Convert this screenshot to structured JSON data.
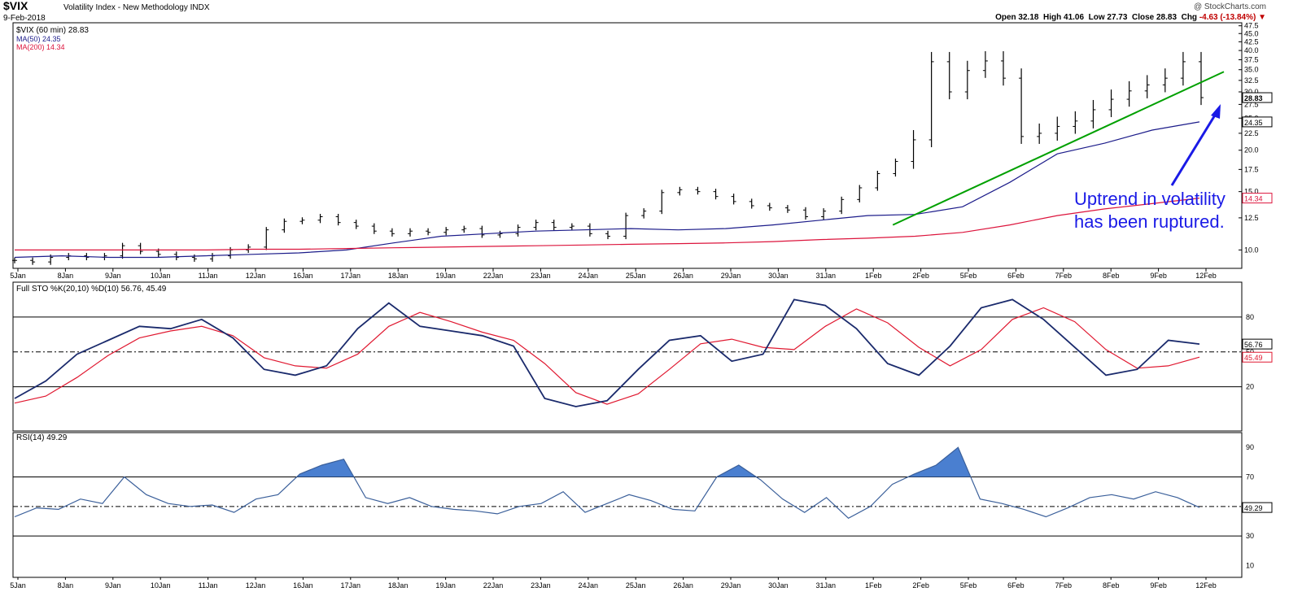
{
  "header": {
    "symbol": "$VIX",
    "name": "Volatility Index - New Methodology  INDX",
    "date": "9-Feb-2018",
    "watermark": "@ StockCharts.com",
    "open_label": "Open",
    "open": "32.18",
    "high_label": "High",
    "high": "41.06",
    "low_label": "Low",
    "low": "27.73",
    "close_label": "Close",
    "close": "28.83",
    "chg_label": "Chg",
    "chg": "-4.63 (-13.84%)",
    "chg_arrow": "▼"
  },
  "colors": {
    "price": "#000000",
    "ma50": "#1c1c8a",
    "ma200": "#dc143c",
    "trendline": "#00a000",
    "annotation": "#1a1ae6",
    "sto_k": "#1a2a6c",
    "sto_d": "#e01830",
    "rsi_line": "#3a5f9a",
    "rsi_fill": "#4a7fd0"
  },
  "x_axis_dates": [
    "5Jan",
    "8Jan",
    "9Jan",
    "10Jan",
    "11Jan",
    "12Jan",
    "16Jan",
    "17Jan",
    "18Jan",
    "19Jan",
    "22Jan",
    "23Jan",
    "24Jan",
    "25Jan",
    "26Jan",
    "29Jan",
    "30Jan",
    "31Jan",
    "1Feb",
    "2Feb",
    "5Feb",
    "6Feb",
    "7Feb",
    "8Feb",
    "9Feb",
    "12Feb"
  ],
  "chart_data": [
    {
      "type": "line",
      "panel": "price",
      "title": "$VIX (60 min) 28.83",
      "x": [
        "5Jan",
        "8Jan",
        "9Jan",
        "10Jan",
        "11Jan",
        "12Jan",
        "16Jan",
        "17Jan",
        "18Jan",
        "19Jan",
        "22Jan",
        "23Jan",
        "24Jan",
        "25Jan",
        "26Jan",
        "29Jan",
        "30Jan",
        "31Jan",
        "1Feb",
        "2Feb",
        "5Feb",
        "6Feb",
        "7Feb",
        "8Feb",
        "9Feb"
      ],
      "y_scale": "log",
      "ylim": [
        8.8,
        48.5
      ],
      "y_ticks": [
        "47.5",
        "45.0",
        "42.5",
        "40.0",
        "37.5",
        "35.0",
        "32.5",
        "30.0",
        "27.5",
        "25.0",
        "22.5",
        "20.0",
        "17.5",
        "15.0",
        "12.5",
        "10.0"
      ],
      "value_labels": {
        "close": "28.83",
        "ma50": "24.35",
        "ma200": "14.34"
      },
      "series": [
        {
          "name": "$VIX (60 min) 28.83",
          "style": "ohlc-bars",
          "values": [
            9.3,
            9.2,
            9.5,
            9.6,
            9.5,
            9.6,
            10.3,
            9.9,
            9.7,
            9.5,
            9.4,
            9.6,
            10.0,
            10.2,
            11.5,
            12.2,
            12.3,
            12.6,
            12.1,
            11.8,
            11.4,
            11.2,
            11.4,
            11.3,
            11.5,
            11.6,
            11.1,
            11.2,
            11.7,
            12.1,
            11.7,
            11.8,
            11.2,
            11.0,
            12.7,
            13.1,
            14.9,
            15.2,
            15.0,
            14.5,
            14.0,
            13.6,
            13.4,
            13.2,
            12.6,
            13.1,
            14.2,
            15.4,
            17.0,
            18.5,
            21.5,
            37.0,
            30.0,
            34.8,
            37.2,
            33.0,
            22.0,
            22.5,
            23.6,
            24.5,
            26.5,
            28.5,
            30.2,
            31.5,
            33.0,
            37.0,
            28.83
          ]
        },
        {
          "name": "MA(50) 24.35",
          "style": "line",
          "values": [
            9.5,
            9.6,
            9.5,
            9.5,
            9.6,
            9.7,
            9.8,
            10.0,
            10.5,
            11.0,
            11.2,
            11.4,
            11.5,
            11.6,
            11.5,
            11.6,
            11.9,
            12.3,
            12.7,
            12.8,
            13.5,
            16.0,
            19.5,
            21.0,
            23.0,
            24.35
          ]
        },
        {
          "name": "MA(200) 14.34",
          "style": "line",
          "values": [
            10.0,
            10.0,
            10.0,
            10.0,
            10.0,
            10.05,
            10.05,
            10.1,
            10.15,
            10.2,
            10.25,
            10.3,
            10.35,
            10.4,
            10.45,
            10.5,
            10.6,
            10.75,
            10.85,
            11.0,
            11.3,
            11.9,
            12.7,
            13.3,
            13.8,
            14.34
          ]
        }
      ],
      "annotations": [
        {
          "type": "trendline",
          "from": [
            "1Feb",
            11.9
          ],
          "to": [
            "12Feb",
            34.5
          ]
        },
        {
          "type": "text",
          "lines": [
            "Uptrend in volatility",
            "has been ruptured."
          ]
        }
      ]
    },
    {
      "type": "line",
      "panel": "stochastic",
      "title": "Full STO %K(20,10) %D(10) 56.76, 45.49",
      "ylim": [
        -18,
        110
      ],
      "y_ticks": [
        "80",
        "50",
        "20"
      ],
      "reference_lines": {
        "solid": [
          80,
          20
        ],
        "dashed": [
          50
        ]
      },
      "value_labels": {
        "k": "56.76",
        "d": "45.49"
      },
      "series": [
        {
          "name": "%K(20,10)",
          "values": [
            10,
            25,
            48,
            60,
            72,
            70,
            78,
            62,
            35,
            30,
            38,
            70,
            92,
            72,
            68,
            64,
            55,
            10,
            3,
            8,
            35,
            60,
            64,
            42,
            48,
            95,
            90,
            70,
            40,
            30,
            55,
            88,
            95,
            78,
            54,
            30,
            35,
            60,
            56.76
          ]
        },
        {
          "name": "%D(10)",
          "values": [
            6,
            12,
            28,
            47,
            62,
            68,
            72,
            64,
            45,
            38,
            36,
            48,
            72,
            84,
            76,
            67,
            60,
            40,
            15,
            5,
            14,
            35,
            57,
            61,
            54,
            52,
            72,
            87,
            75,
            54,
            38,
            52,
            78,
            88,
            76,
            52,
            36,
            38,
            45.49
          ]
        }
      ]
    },
    {
      "type": "area",
      "panel": "rsi",
      "title": "RSI(14) 49.29",
      "ylim": [
        2,
        100
      ],
      "y_ticks": [
        "90",
        "70",
        "50",
        "30",
        "10"
      ],
      "reference_lines": {
        "solid": [
          70,
          30
        ],
        "dashed": [
          50
        ]
      },
      "value_labels": {
        "rsi": "49.29"
      },
      "fill_above": 70,
      "series": [
        {
          "name": "RSI(14)",
          "values": [
            43,
            49,
            48,
            55,
            52,
            70,
            58,
            52,
            50,
            51,
            46,
            55,
            58,
            72,
            78,
            82,
            56,
            52,
            56,
            50,
            48,
            47,
            45,
            50,
            52,
            60,
            46,
            52,
            58,
            54,
            48,
            47,
            70,
            78,
            68,
            55,
            46,
            56,
            42,
            50,
            65,
            72,
            78,
            90,
            55,
            52,
            48,
            43,
            49,
            56,
            58,
            55,
            60,
            56,
            49.29
          ]
        }
      ]
    }
  ]
}
